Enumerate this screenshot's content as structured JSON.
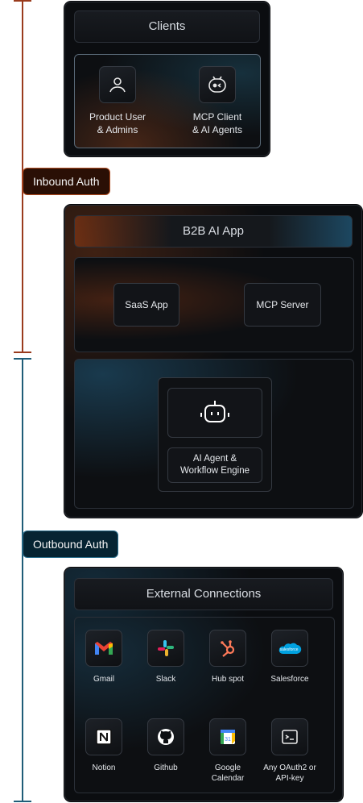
{
  "clients": {
    "title": "Clients",
    "items": [
      {
        "label": "Product User\n& Admins",
        "icon": "user-icon"
      },
      {
        "label": "MCP Client\n& AI Agents",
        "icon": "robot-face-icon"
      }
    ]
  },
  "inbound": {
    "label": "Inbound Auth",
    "color": "#9a3b1d"
  },
  "outbound": {
    "label": "Outbound Auth",
    "color": "#1f5d78"
  },
  "app": {
    "title": "B2B AI App",
    "saas": "SaaS App",
    "mcp_server": "MCP Server",
    "engine": "AI Agent &\nWorkflow Engine"
  },
  "external": {
    "title": "External Connections",
    "items": [
      {
        "label": "Gmail",
        "icon": "gmail-icon"
      },
      {
        "label": "Slack",
        "icon": "slack-icon"
      },
      {
        "label": "Hub spot",
        "icon": "hubspot-icon"
      },
      {
        "label": "Salesforce",
        "icon": "salesforce-icon"
      },
      {
        "label": "Notion",
        "icon": "notion-icon"
      },
      {
        "label": "Github",
        "icon": "github-icon"
      },
      {
        "label": "Google\nCalendar",
        "icon": "google-calendar-icon"
      },
      {
        "label": "Any OAuth2 or\nAPI-key",
        "icon": "terminal-icon"
      }
    ]
  }
}
